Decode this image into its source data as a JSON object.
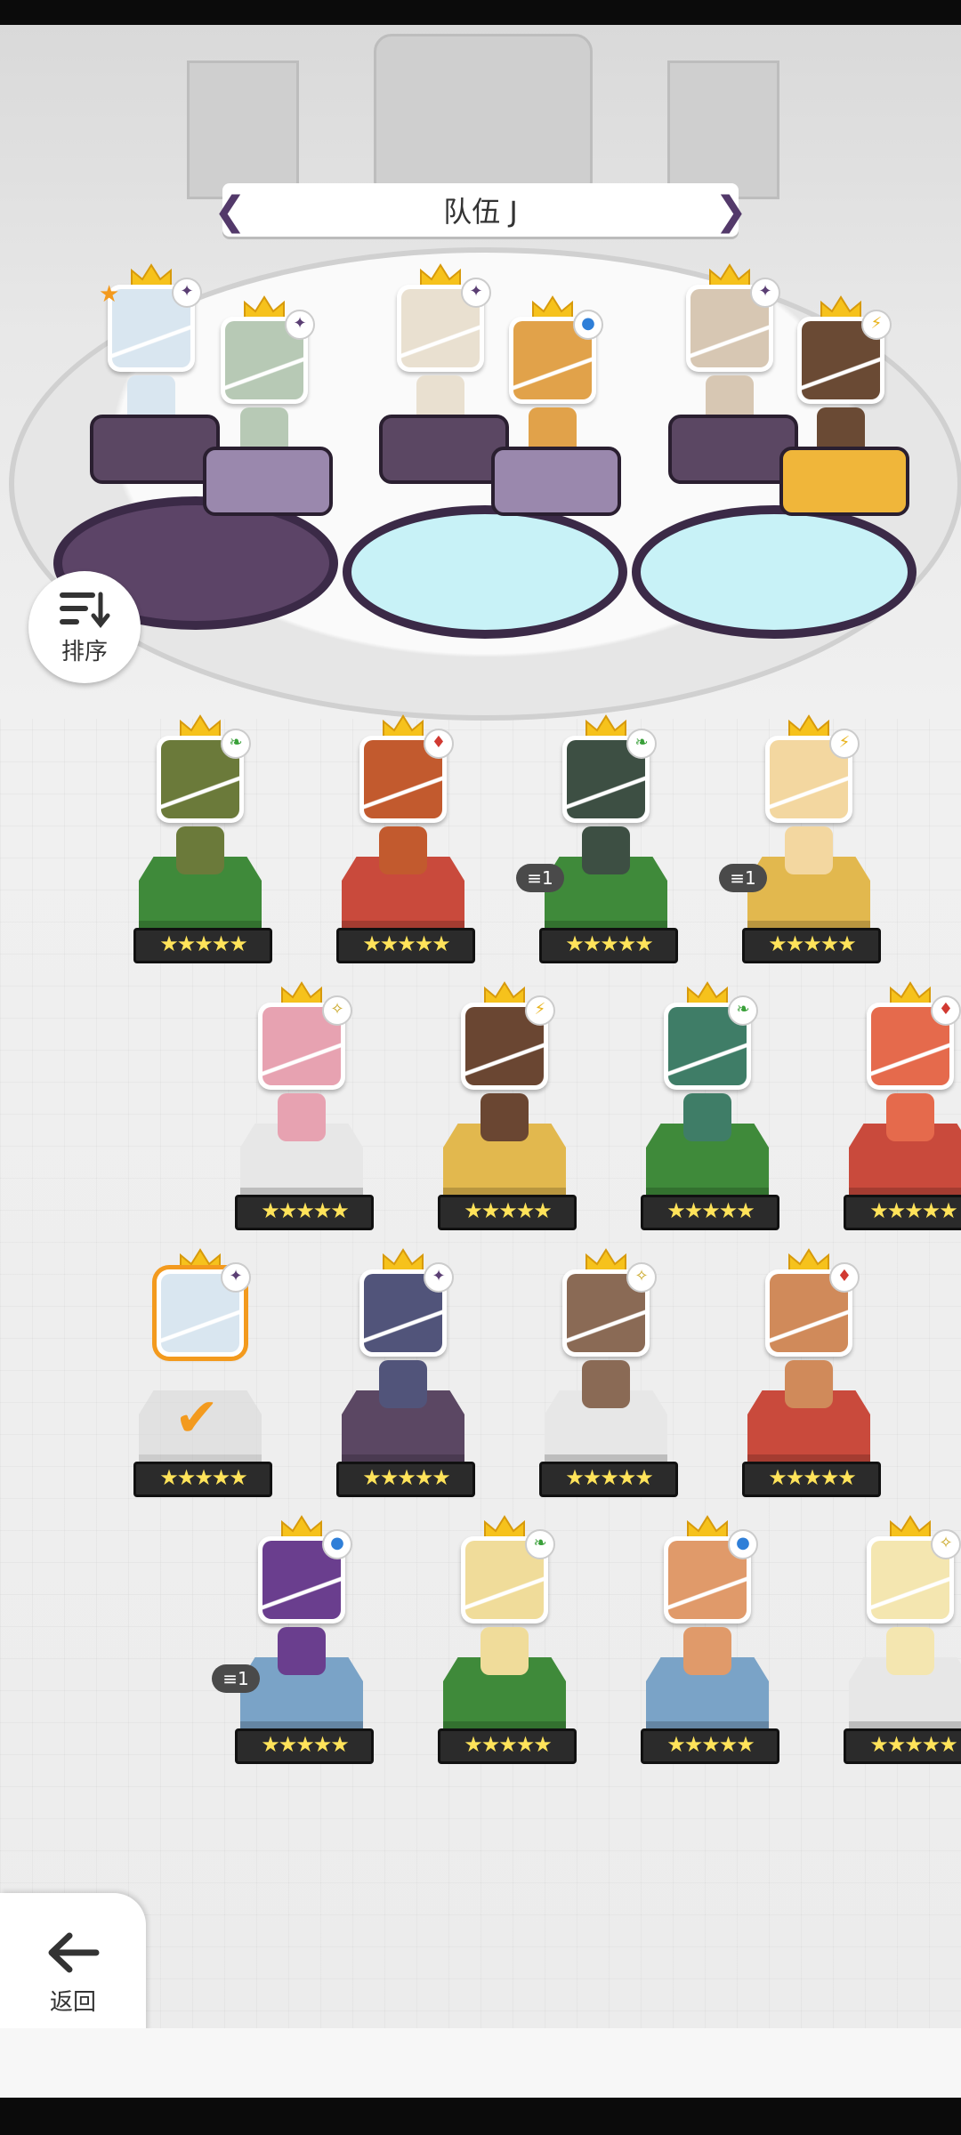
{
  "team": {
    "title": "队伍 J"
  },
  "sort_button": {
    "label": "排序",
    "icon": "sort-icon"
  },
  "back_button": {
    "label": "返回",
    "icon": "arrow-left-icon"
  },
  "team_members": [
    {
      "face": "#d9e6f0",
      "elem": "dark",
      "star_badge": true
    },
    {
      "face": "#b7c9b5",
      "elem": "dark"
    },
    {
      "face": "#e9e0d0",
      "elem": "dark"
    },
    {
      "face": "#e1a24a",
      "elem": "water"
    },
    {
      "face": "#d7c7b3",
      "elem": "dark"
    },
    {
      "face": "#6a4a34",
      "elem": "thunder"
    }
  ],
  "roster": [
    {
      "row": 0,
      "col": 0,
      "face": "#6b7a3a",
      "elem": "wind",
      "pedestal": "#3f8a3a",
      "stars": "★★★★★"
    },
    {
      "row": 0,
      "col": 1,
      "face": "#c25a2e",
      "elem": "fire",
      "pedestal": "#c94a3c",
      "stars": "★★★★★"
    },
    {
      "row": 0,
      "col": 2,
      "face": "#3d4f43",
      "elem": "wind",
      "pedestal": "#3f8a3a",
      "stars": "★★★★★",
      "badge": "1"
    },
    {
      "row": 0,
      "col": 3,
      "face": "#f3d7a0",
      "elem": "thunder",
      "pedestal": "#e2b84e",
      "stars": "★★★★★",
      "badge": "1"
    },
    {
      "row": 1,
      "col": 0,
      "face": "#e7a2b1",
      "elem": "light",
      "pedestal": "#e7e7e7",
      "stars": "★★★★★"
    },
    {
      "row": 1,
      "col": 1,
      "face": "#6a4632",
      "elem": "thunder",
      "pedestal": "#e2b84e",
      "stars": "★★★★★"
    },
    {
      "row": 1,
      "col": 2,
      "face": "#3f7d67",
      "elem": "wind",
      "pedestal": "#3f8a3a",
      "stars": "★★★★★"
    },
    {
      "row": 1,
      "col": 3,
      "face": "#e56a4c",
      "elem": "fire",
      "pedestal": "#c94a3c",
      "stars": "★★★★★"
    },
    {
      "row": 2,
      "col": 0,
      "face": "#d9e6f0",
      "elem": "dark",
      "pedestal": "#d8d8d8",
      "stars": "★★★★★",
      "selected": true
    },
    {
      "row": 2,
      "col": 1,
      "face": "#51547a",
      "elem": "dark",
      "pedestal": "#5b4763",
      "stars": "★★★★★"
    },
    {
      "row": 2,
      "col": 2,
      "face": "#8a6a55",
      "elem": "light",
      "pedestal": "#e7e7e7",
      "stars": "★★★★★"
    },
    {
      "row": 2,
      "col": 3,
      "face": "#d08a5a",
      "elem": "fire",
      "pedestal": "#c94a3c",
      "stars": "★★★★★"
    },
    {
      "row": 3,
      "col": 0,
      "face": "#6a3e8e",
      "elem": "water",
      "pedestal": "#7aa3c7",
      "stars": "★★★★★",
      "badge": "1"
    },
    {
      "row": 3,
      "col": 1,
      "face": "#f0dc9a",
      "elem": "wind",
      "pedestal": "#3f8a3a",
      "stars": "★★★★★"
    },
    {
      "row": 3,
      "col": 2,
      "face": "#e09a6a",
      "elem": "water",
      "pedestal": "#7aa3c7",
      "stars": "★★★★★"
    },
    {
      "row": 3,
      "col": 3,
      "face": "#f4e6b0",
      "elem": "light",
      "pedestal": "#e7e7e7",
      "stars": "★★★★★"
    }
  ],
  "element_icons": {
    "dark": "✦",
    "water": "●",
    "thunder": "⚡",
    "wind": "❧",
    "fire": "♦",
    "light": "✧"
  },
  "element_colors": {
    "dark": "#5b3f74",
    "water": "#2f7fd8",
    "thunder": "#e8b21a",
    "wind": "#3aa03a",
    "fire": "#d13a32",
    "light": "#c9a623"
  }
}
